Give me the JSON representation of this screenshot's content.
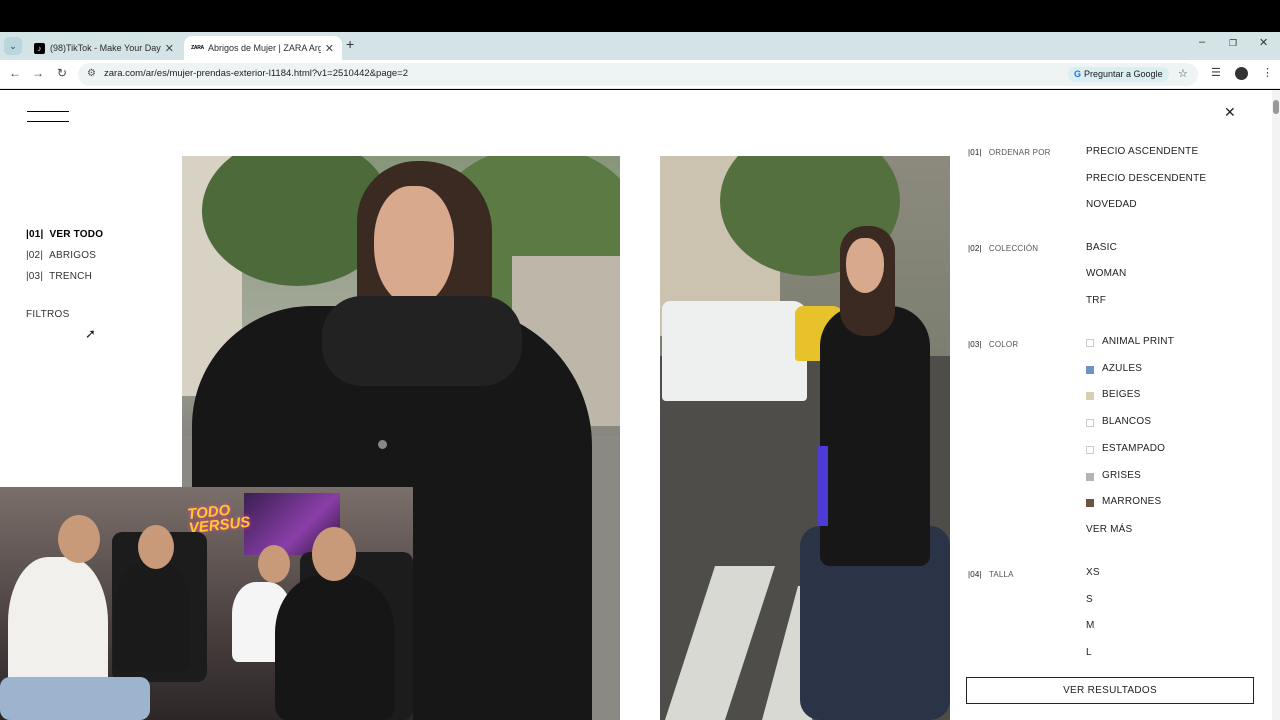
{
  "browser": {
    "tabs": [
      {
        "title": "(98)TikTok - Make Your Day",
        "favicon": "tiktok-icon",
        "active": false
      },
      {
        "title": "Abrigos de Mujer | ZARA Argen",
        "favicon": "zara-icon",
        "active": true
      }
    ],
    "url": "zara.com/ar/es/mujer-prendas-exterior-l1184.html?v1=2510442&page=2",
    "ask_google_label": "Preguntar a Google",
    "icons": {
      "tab_search": "⌄",
      "tab_close": "✕",
      "new_tab": "+",
      "back": "←",
      "forward": "→",
      "reload": "↻",
      "site_info": "⚙",
      "star": "☆",
      "minimize": "–",
      "restore": "❐",
      "window_close": "✕",
      "reading_list": "☰",
      "more": "⋮",
      "ask_google": "G"
    }
  },
  "page": {
    "close_icon": "✕",
    "categories": [
      {
        "num": "|01|",
        "label": "VER TODO",
        "selected": true
      },
      {
        "num": "|02|",
        "label": "ABRIGOS",
        "selected": false
      },
      {
        "num": "|03|",
        "label": "TRENCH",
        "selected": false
      }
    ],
    "filters_label": "FILTROS",
    "filter_panel": {
      "order": {
        "num": "|01|",
        "label": "ORDENAR POR",
        "options": [
          "PRECIO ASCENDENTE",
          "PRECIO DESCENDENTE",
          "NOVEDAD"
        ]
      },
      "collection": {
        "num": "|02|",
        "label": "COLECCIÓN",
        "options": [
          "BASIC",
          "WOMAN",
          "TRF"
        ]
      },
      "color": {
        "num": "|03|",
        "label": "COLOR",
        "options": [
          {
            "label": "ANIMAL PRINT",
            "swatch": "#ffffff"
          },
          {
            "label": "AZULES",
            "swatch": "#6f93c0"
          },
          {
            "label": "BEIGES",
            "swatch": "#d9cfb0"
          },
          {
            "label": "BLANCOS",
            "swatch": "#ffffff"
          },
          {
            "label": "ESTAMPADO",
            "swatch": "#ffffff"
          },
          {
            "label": "GRISES",
            "swatch": "#b3b3b3"
          },
          {
            "label": "MARRONES",
            "swatch": "#6b5540"
          }
        ],
        "more_label": "VER MÁS"
      },
      "size": {
        "num": "|04|",
        "label": "TALLA",
        "options": [
          "XS",
          "S",
          "M",
          "L"
        ]
      },
      "results_button": "VER RESULTADOS"
    },
    "video_overlay": {
      "logo_text": "TODO VERSUS"
    }
  }
}
